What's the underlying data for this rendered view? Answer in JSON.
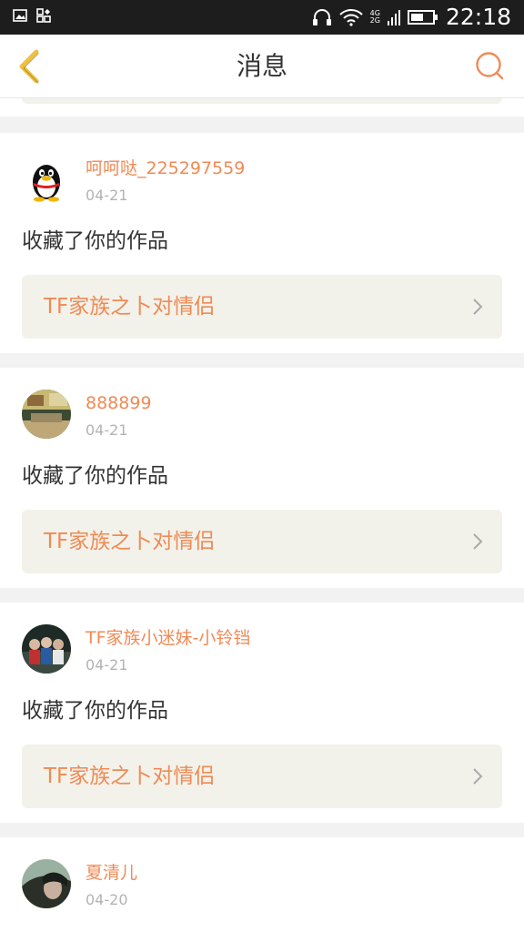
{
  "status_bar": {
    "time": "22:18",
    "network_top": "4G",
    "network_bottom": "2G",
    "icons": [
      "image-icon",
      "grid-icon",
      "headphones-icon",
      "wifi-icon",
      "signal-icon",
      "battery-icon"
    ]
  },
  "header": {
    "title": "消息",
    "back_icon": "chevron-left-icon",
    "search_icon": "search-icon",
    "accent_color": "#f08a55",
    "back_color": "#f0c040"
  },
  "messages": [
    {
      "username": "呵呵哒_225297559",
      "date": "04-21",
      "action": "收藏了你的作品",
      "work_title": "TF家族之卜对情侣",
      "avatar": "qq-penguin-avatar"
    },
    {
      "username": "888899",
      "date": "04-21",
      "action": "收藏了你的作品",
      "work_title": "TF家族之卜对情侣",
      "avatar": "room-photo-avatar"
    },
    {
      "username": "TF家族小迷妹-小铃铛",
      "date": "04-21",
      "action": "收藏了你的作品",
      "work_title": "TF家族之卜对情侣",
      "avatar": "group-photo-avatar"
    },
    {
      "username": "夏清儿",
      "date": "04-20",
      "avatar": "portrait-avatar"
    }
  ]
}
